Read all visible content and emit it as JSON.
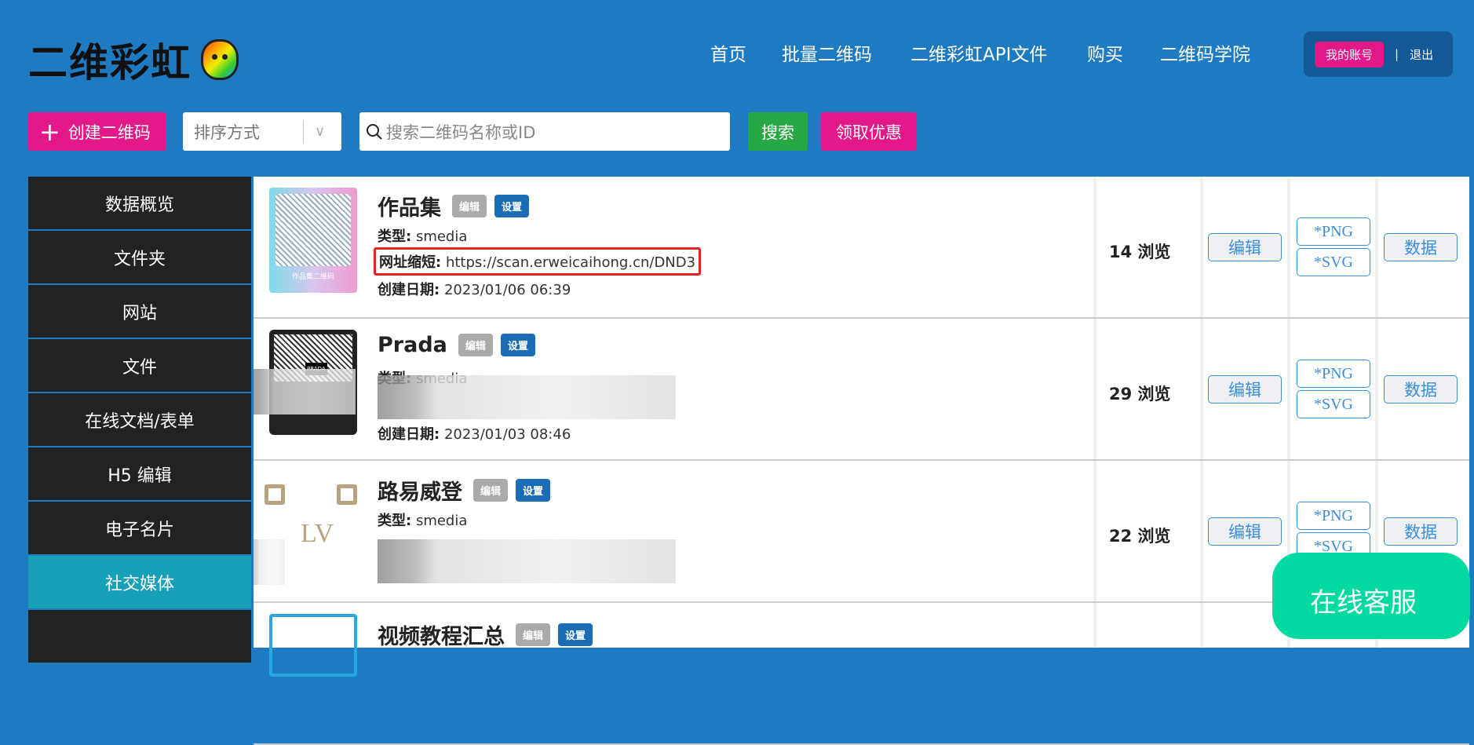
{
  "header": {
    "logo": "二维彩虹",
    "nav": [
      "首页",
      "批量二维码",
      "二维彩虹API文件",
      "购买",
      "二维码学院"
    ],
    "account": "我的账号",
    "separator": "|",
    "logout": "退出"
  },
  "toolbar": {
    "create_icon": "+",
    "create": "创建二维码",
    "sort_placeholder": "排序方式",
    "sort_chevron": "∨",
    "search_placeholder": "搜索二维码名称或ID",
    "search": "搜索",
    "coupon": "领取优惠"
  },
  "sidebar": {
    "items": [
      "数据概览",
      "文件夹",
      "网站",
      "文件",
      "在线文档/表单",
      "H5 编辑",
      "电子名片",
      "社交媒体"
    ],
    "active": "社交媒体"
  },
  "labels": {
    "edit_tag": "编辑",
    "settings_tag": "设置",
    "type": "类型:",
    "short_url": "网址缩短:",
    "created": "创建日期:",
    "edit": "编辑",
    "png": "*PNG",
    "svg": "*SVG",
    "data": "数据"
  },
  "rows": [
    {
      "name": "作品集",
      "qr_caption": "作品集二维码",
      "type": "smedia",
      "url": "https://scan.erweicaihong.cn/DND3",
      "date": "2023/01/06 06:39",
      "views": "14 浏览"
    },
    {
      "name": "Prada",
      "qr_caption": "PRADA",
      "type": "smedia",
      "date": "2023/01/03 08:46",
      "views": "29 浏览"
    },
    {
      "name": "路易威登",
      "qr_caption": "LV",
      "type": "smedia",
      "views": "22 浏览"
    },
    {
      "name": "视频教程汇总"
    }
  ],
  "support": "在线客服",
  "colors": {
    "header": "#1f7bc1",
    "pink": "#e3198a",
    "green": "#28a745",
    "sidebar_active": "#17a0b8",
    "support": "#00d9a0"
  }
}
